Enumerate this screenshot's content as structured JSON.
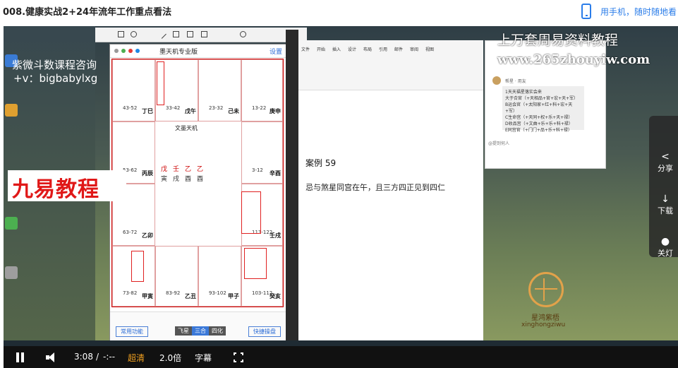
{
  "header": {
    "title": "008.健康实战2+24年流年工作重点看法",
    "mobile_link": "用手机，随时随地看"
  },
  "overlay": {
    "course": "紫微斗数课程咨询",
    "contact": "+v：bigbabylxg",
    "brand": "九易教程",
    "promo_title": "上万套周易资料教程",
    "promo_url": "www.265zhouyiw.com",
    "logo_name": "星鸿紫梧",
    "logo_pinyin": "xinghongziwu"
  },
  "app": {
    "title": "墨天机专业版",
    "settings": "设置",
    "center_title": "文墨天机",
    "pillars": [
      "戊",
      "壬",
      "乙",
      "乙"
    ],
    "pillars_branch": [
      "寅",
      "戌",
      "酉",
      "酉"
    ],
    "cells": [
      {
        "age": "43-52",
        "gz": "丁巳"
      },
      {
        "age": "33-42",
        "gz": "戊午"
      },
      {
        "age": "23-32",
        "gz": "己未"
      },
      {
        "age": "13-22",
        "gz": "庚申"
      },
      {
        "age": "53-62",
        "gz": "丙辰"
      },
      {
        "age": "3-12",
        "gz": "辛酉"
      },
      {
        "age": "63-72",
        "gz": "乙卯"
      },
      {
        "age": "113-122",
        "gz": "壬戌"
      },
      {
        "age": "73-82",
        "gz": "甲寅"
      },
      {
        "age": "83-92",
        "gz": "乙丑"
      },
      {
        "age": "93-102",
        "gz": "甲子"
      },
      {
        "age": "103-112",
        "gz": "癸亥"
      }
    ],
    "common_btn": "常用功能",
    "segments": [
      "飞星",
      "三合",
      "四化"
    ],
    "active_segment": "三合",
    "quick_btn": "快捷操盘"
  },
  "doc": {
    "tabs": [
      "文件",
      "开始",
      "插入",
      "设计",
      "布局",
      "引用",
      "邮件",
      "审阅",
      "视图"
    ],
    "case_title": "案例 59",
    "case_text": "忌与煞星同宫在午，且三方四正见到四仁",
    "comment_author": "帮星 · 用友",
    "comment_lines": [
      "1天天福星落实会来",
      "大于合官（+天相品+官+宏+天+军）",
      "B运会官（+太阳家+红+科+宏+天+军）",
      "C生命宫（+天同+权+乐+天+禄）",
      "D收品宫（+文曲+乐+乐+科+禄）",
      "E同宫官（+门门+品+乐+科+禄）"
    ],
    "comment_mention": "@提到何人"
  },
  "side_panel": {
    "share": "分享",
    "download": "下载",
    "lights": "关灯"
  },
  "controls": {
    "time": "3:08",
    "separator": "/",
    "duration": "-:--",
    "quality": "超清",
    "speed": "2.0倍",
    "subtitles": "字幕"
  },
  "colors": {
    "accent": "#2b7de9",
    "quality": "#f0a020",
    "brand_red": "#e01818"
  }
}
